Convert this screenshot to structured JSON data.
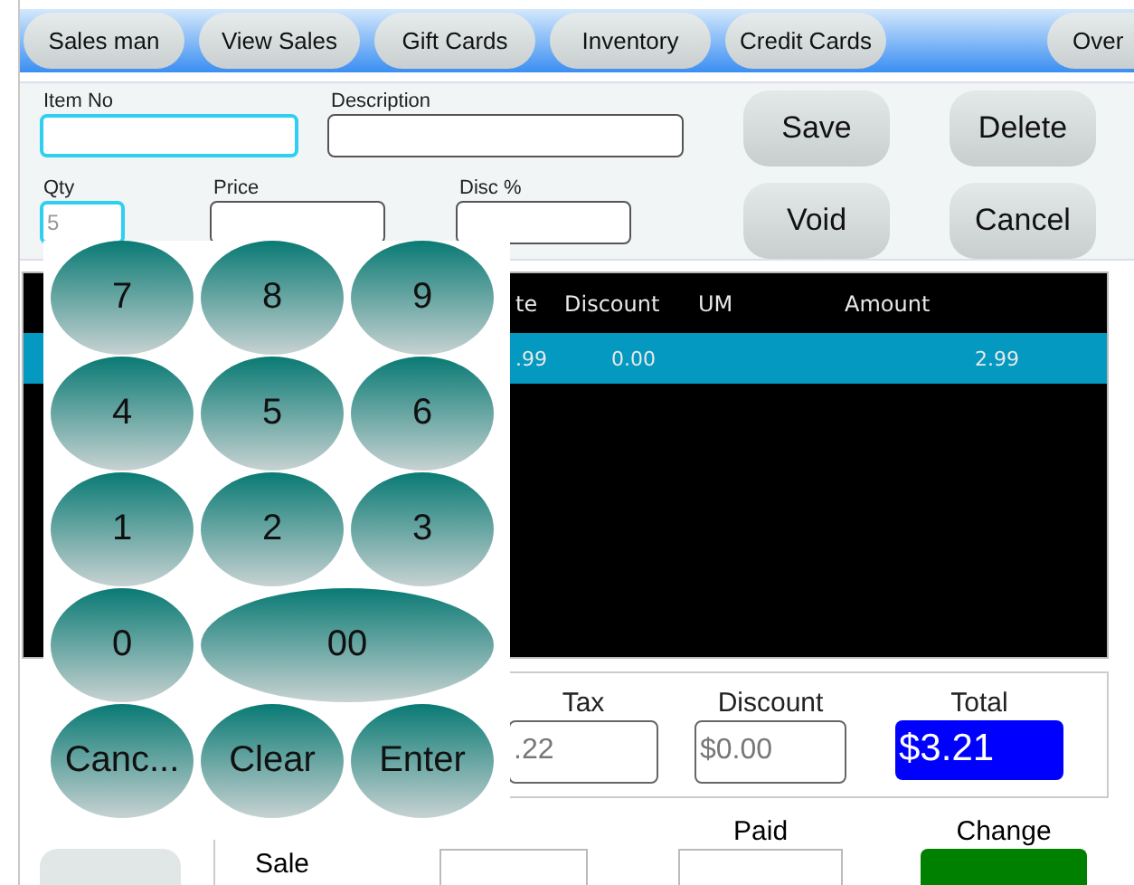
{
  "toolbar": [
    {
      "label": "Sales man"
    },
    {
      "label": "View Sales"
    },
    {
      "label": "Gift Cards"
    },
    {
      "label": "Inventory"
    },
    {
      "label": "Credit Cards"
    },
    {
      "label": "Over"
    }
  ],
  "item_form": {
    "item_no": {
      "label": "Item No",
      "focused": true
    },
    "description": {
      "label": "Description",
      "focused": false
    },
    "qty": {
      "label": "Qty",
      "placeholder": "5",
      "focused": true
    },
    "price": {
      "label": "Price",
      "focused": false
    },
    "disc": {
      "label": "Disc %",
      "focused": false
    }
  },
  "actions": [
    "Save",
    "Delete",
    "Void",
    "Cancel"
  ],
  "table": {
    "columns": [
      "te",
      "Discount",
      "UM",
      "Amount"
    ],
    "rows": [
      {
        "selected": true,
        "cells": [
          ".99",
          "0.00",
          null,
          "2.99"
        ]
      }
    ]
  },
  "keypad": [
    {
      "label": "7",
      "kind": "key"
    },
    {
      "label": "8",
      "kind": "key"
    },
    {
      "label": "9",
      "kind": "key"
    },
    {
      "label": "4",
      "kind": "key"
    },
    {
      "label": "5",
      "kind": "key"
    },
    {
      "label": "6",
      "kind": "key"
    },
    {
      "label": "1",
      "kind": "key"
    },
    {
      "label": "2",
      "kind": "key"
    },
    {
      "label": "3",
      "kind": "key"
    },
    {
      "label": "0",
      "kind": "key"
    },
    {
      "label": "00",
      "kind": "wide"
    },
    {
      "label": "Canc...",
      "kind": "key"
    },
    {
      "label": "Clear",
      "kind": "key"
    },
    {
      "label": "Enter",
      "kind": "key"
    }
  ],
  "totals": {
    "tax": {
      "label": "Tax",
      "value": ".22"
    },
    "discount": {
      "label": "Discount",
      "value": "$0.00"
    },
    "total": {
      "label": "Total",
      "value": "$3.21"
    }
  },
  "payment": {
    "sale_label": "Sale",
    "paid_label": "Paid",
    "change_label": "Change"
  }
}
